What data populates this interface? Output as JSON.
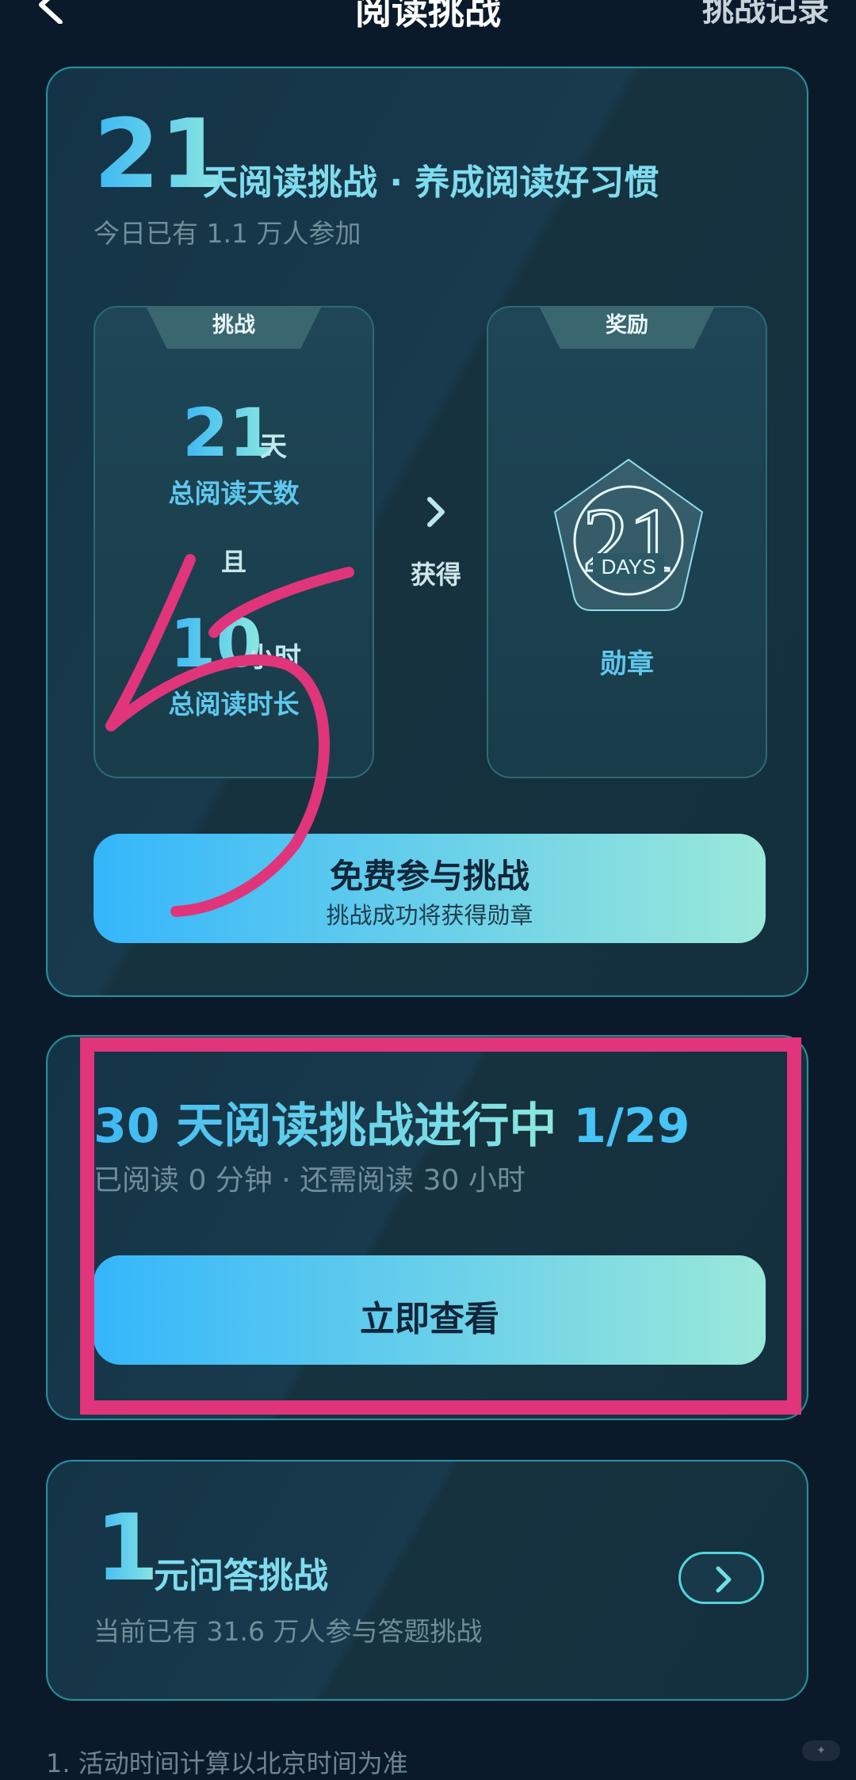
{
  "header": {
    "title": "阅读挑战",
    "record_link": "挑战记录"
  },
  "challenge21": {
    "days_number": "21",
    "title": "天阅读挑战 · 养成阅读好习惯",
    "participants": "今日已有 1.1 万人参加",
    "challenge_panel": {
      "tab": "挑战",
      "days_value": "21",
      "days_unit": "天",
      "days_label": "总阅读天数",
      "and_label": "且",
      "hours_value": "10",
      "hours_unit": "小时",
      "hours_label": "总阅读时长"
    },
    "arrow_label": "获得",
    "reward_panel": {
      "tab": "奖励",
      "badge_text": "DAYS",
      "badge_number": "21",
      "medal_label": "勋章"
    },
    "button": {
      "label": "免费参与挑战",
      "sub": "挑战成功将获得勋章"
    }
  },
  "challenge30": {
    "title": "30 天阅读挑战进行中",
    "progress": "1/29",
    "status": "已阅读 0 分钟 · 还需阅读 30 小时",
    "button_label": "立即查看"
  },
  "quiz": {
    "number": "1",
    "title": "元问答挑战",
    "participants": "当前已有 31.6 万人参与答题挑战"
  },
  "rules": {
    "first": "1. 活动时间计算以北京时间为准"
  },
  "colors": {
    "background": "#0a1a2a",
    "accent_start": "#35b6fb",
    "accent_end": "#9ae8d9",
    "annotation": "#e0357a"
  }
}
